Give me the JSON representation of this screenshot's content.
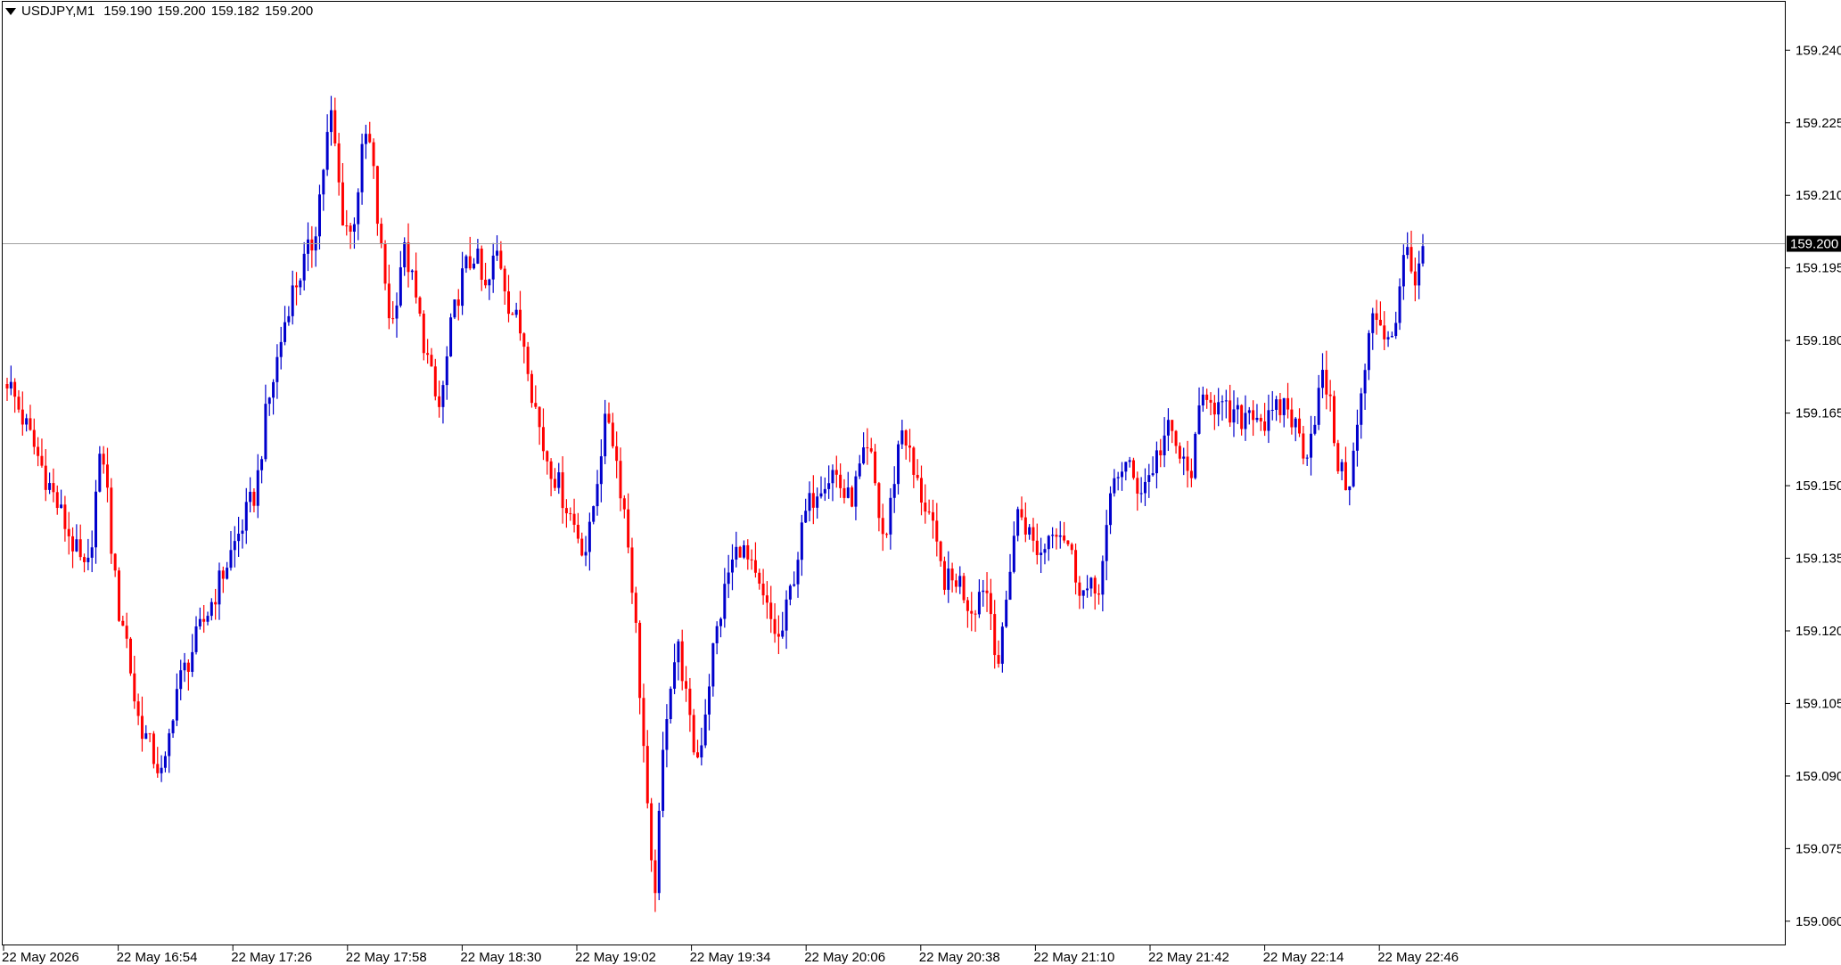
{
  "header": {
    "symbol": "USDJPY,M1",
    "open": "159.190",
    "high": "159.200",
    "low": "159.182",
    "close": "159.200"
  },
  "colors": {
    "bull": "#0000cc",
    "bear": "#ff0000",
    "frame": "#000000",
    "price_line": "#a0a0a0",
    "price_label_bg": "#000000",
    "price_label_text": "#ffffff"
  },
  "chart_data": {
    "type": "candlestick",
    "symbol": "USDJPY",
    "timeframe": "M1",
    "ylim": [
      159.055,
      159.25
    ],
    "y_ticks": [
      "159.240",
      "159.225",
      "159.210",
      "159.195",
      "159.180",
      "159.165",
      "159.150",
      "159.135",
      "159.120",
      "159.105",
      "159.090",
      "159.075",
      "159.060"
    ],
    "x_ticks": [
      "22 May 2026",
      "22 May 16:54",
      "22 May 17:26",
      "22 May 17:58",
      "22 May 18:30",
      "22 May 19:02",
      "22 May 19:34",
      "22 May 20:06",
      "22 May 20:38",
      "22 May 21:10",
      "22 May 21:42",
      "22 May 22:14",
      "22 May 22:46"
    ],
    "current_price": "159.200",
    "grid": false,
    "closes": [
      159.172,
      159.17,
      159.168,
      159.166,
      159.164,
      159.162,
      159.16,
      159.158,
      159.156,
      159.154,
      159.152,
      159.15,
      159.148,
      159.146,
      159.144,
      159.142,
      159.14,
      159.138,
      159.136,
      159.134,
      159.132,
      159.133,
      159.14,
      159.148,
      159.154,
      159.156,
      159.148,
      159.138,
      159.13,
      159.124,
      159.122,
      159.118,
      159.112,
      159.106,
      159.102,
      159.1,
      159.098,
      159.096,
      159.094,
      159.092,
      159.09,
      159.092,
      159.098,
      159.104,
      159.108,
      159.11,
      159.112,
      159.114,
      159.116,
      159.118,
      159.12,
      159.122,
      159.124,
      159.126,
      159.128,
      159.13,
      159.132,
      159.134,
      159.136,
      159.138,
      159.14,
      159.142,
      159.144,
      159.146,
      159.148,
      159.152,
      159.158,
      159.164,
      159.168,
      159.172,
      159.176,
      159.18,
      159.184,
      159.188,
      159.19,
      159.192,
      159.194,
      159.196,
      159.198,
      159.2,
      159.204,
      159.21,
      159.216,
      159.222,
      159.226,
      159.22,
      159.212,
      159.206,
      159.204,
      159.202,
      159.206,
      159.212,
      159.218,
      159.222,
      159.22,
      159.214,
      159.205,
      159.198,
      159.192,
      159.186,
      159.184,
      159.19,
      159.196,
      159.198,
      159.196,
      159.192,
      159.188,
      159.184,
      159.18,
      159.176,
      159.172,
      159.168,
      159.166,
      159.17,
      159.176,
      159.182,
      159.186,
      159.19,
      159.193,
      159.195,
      159.196,
      159.198,
      159.196,
      159.192,
      159.19,
      159.192,
      159.196,
      159.198,
      159.196,
      159.192,
      159.188,
      159.186,
      159.184,
      159.182,
      159.18,
      159.176,
      159.17,
      159.166,
      159.162,
      159.158,
      159.156,
      159.154,
      159.152,
      159.15,
      159.148,
      159.146,
      159.144,
      159.142,
      159.14,
      159.138,
      159.137,
      159.14,
      159.146,
      159.152,
      159.158,
      159.162,
      159.164,
      159.16,
      159.155,
      159.15,
      159.145,
      159.138,
      159.13,
      159.12,
      159.108,
      159.096,
      159.082,
      159.07,
      159.068,
      159.08,
      159.094,
      159.104,
      159.11,
      159.114,
      159.116,
      159.112,
      159.106,
      159.1,
      159.096,
      159.094,
      159.098,
      159.104,
      159.11,
      159.116,
      159.12,
      159.124,
      159.128,
      159.132,
      159.134,
      159.136,
      159.138,
      159.136,
      159.134,
      159.132,
      159.13,
      159.128,
      159.126,
      159.124,
      159.122,
      159.12,
      159.118,
      159.12,
      159.124,
      159.128,
      159.132,
      159.136,
      159.14,
      159.144,
      159.146,
      159.148,
      159.15,
      159.151,
      159.152,
      159.152,
      159.153,
      159.152,
      159.15,
      159.148,
      159.147,
      159.148,
      159.15,
      159.153,
      159.155,
      159.156,
      159.155,
      159.15,
      159.144,
      159.14,
      159.14,
      159.146,
      159.152,
      159.158,
      159.162,
      159.16,
      159.156,
      159.152,
      159.15,
      159.148,
      159.146,
      159.144,
      159.14,
      159.136,
      159.133,
      159.131,
      159.13,
      159.13,
      159.131,
      159.13,
      159.128,
      159.126,
      159.125,
      159.126,
      159.128,
      159.13,
      159.128,
      159.124,
      159.118,
      159.114,
      159.118,
      159.126,
      159.134,
      159.14,
      159.144,
      159.144,
      159.142,
      159.14,
      159.138,
      159.137,
      159.136,
      159.138,
      159.14,
      159.142,
      159.142,
      159.141,
      159.14,
      159.138,
      159.135,
      159.132,
      159.13,
      159.128,
      159.128,
      159.128,
      159.128,
      159.13,
      159.134,
      159.14,
      159.146,
      159.151,
      159.153,
      159.154,
      159.154,
      159.153,
      159.151,
      159.15,
      159.15,
      159.151,
      159.152,
      159.154,
      159.156,
      159.158,
      159.16,
      159.161,
      159.16,
      159.158,
      159.156,
      159.154,
      159.152,
      159.154,
      159.158,
      159.164,
      159.168,
      159.17,
      159.169,
      159.167,
      159.166,
      159.165,
      159.165,
      159.164,
      159.164,
      159.164,
      159.164,
      159.165,
      159.166,
      159.166,
      159.165,
      159.164,
      159.163,
      159.163,
      159.164,
      159.165,
      159.166,
      159.167,
      159.166,
      159.164,
      159.162,
      159.16,
      159.158,
      159.158,
      159.161,
      159.165,
      159.169,
      159.172,
      159.17,
      159.166,
      159.16,
      159.155,
      159.152,
      159.151,
      159.152,
      159.156,
      159.162,
      159.168,
      159.174,
      159.18,
      159.184,
      159.185,
      159.184,
      159.182,
      159.181,
      159.182,
      159.185,
      159.19,
      159.196,
      159.199,
      159.197,
      159.192,
      159.193,
      159.199
    ]
  }
}
